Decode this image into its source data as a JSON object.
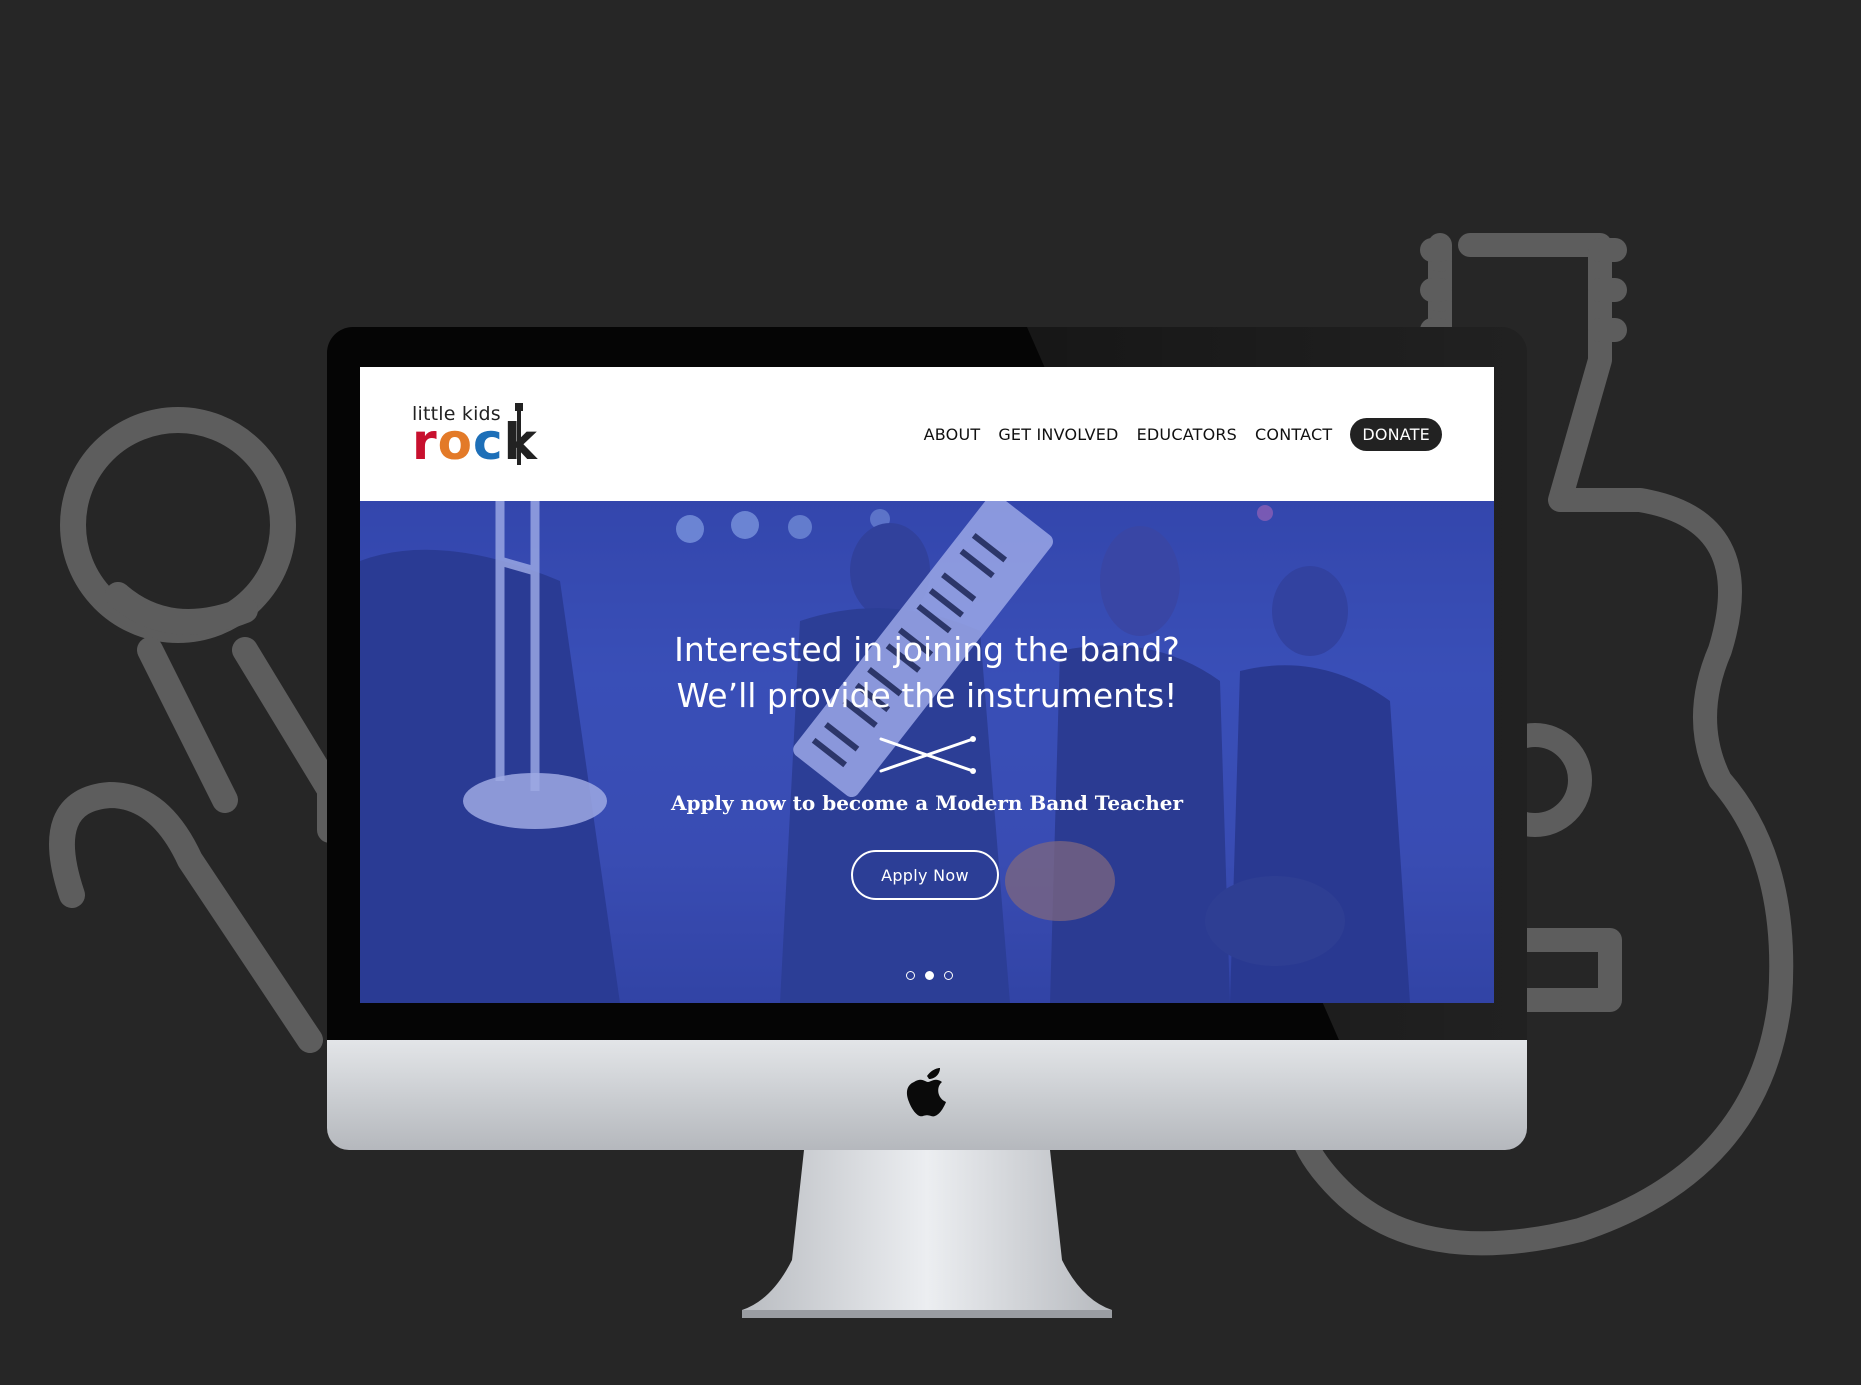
{
  "header": {
    "logo_top": "little kids",
    "logo_word": [
      "r",
      "o",
      "c",
      "k"
    ],
    "nav": [
      {
        "label": "ABOUT"
      },
      {
        "label": "GET INVOLVED"
      },
      {
        "label": "EDUCATORS"
      },
      {
        "label": "CONTACT"
      }
    ],
    "donate_label": "DONATE"
  },
  "hero": {
    "title_line1": "Interested in joining the band?",
    "title_line2": "We’ll provide the instruments!",
    "subtitle": "Apply now to become a Modern Band Teacher",
    "cta_label": "Apply  Now",
    "slides_total": 3,
    "slide_active": 2
  },
  "colors": {
    "background": "#262626",
    "hero_tint": "#3a4fb0",
    "logo_red": "#c8102e",
    "logo_orange": "#e37a28",
    "logo_blue": "#1d6fb8",
    "logo_green": "#7aa63b",
    "icon_gray": "#5d5d5d"
  },
  "decor": {
    "background_icons": [
      "microphone-icon",
      "acoustic-guitar-icon"
    ],
    "hero_icon": "drumsticks-icon",
    "device_logo": "apple-logo-icon"
  }
}
